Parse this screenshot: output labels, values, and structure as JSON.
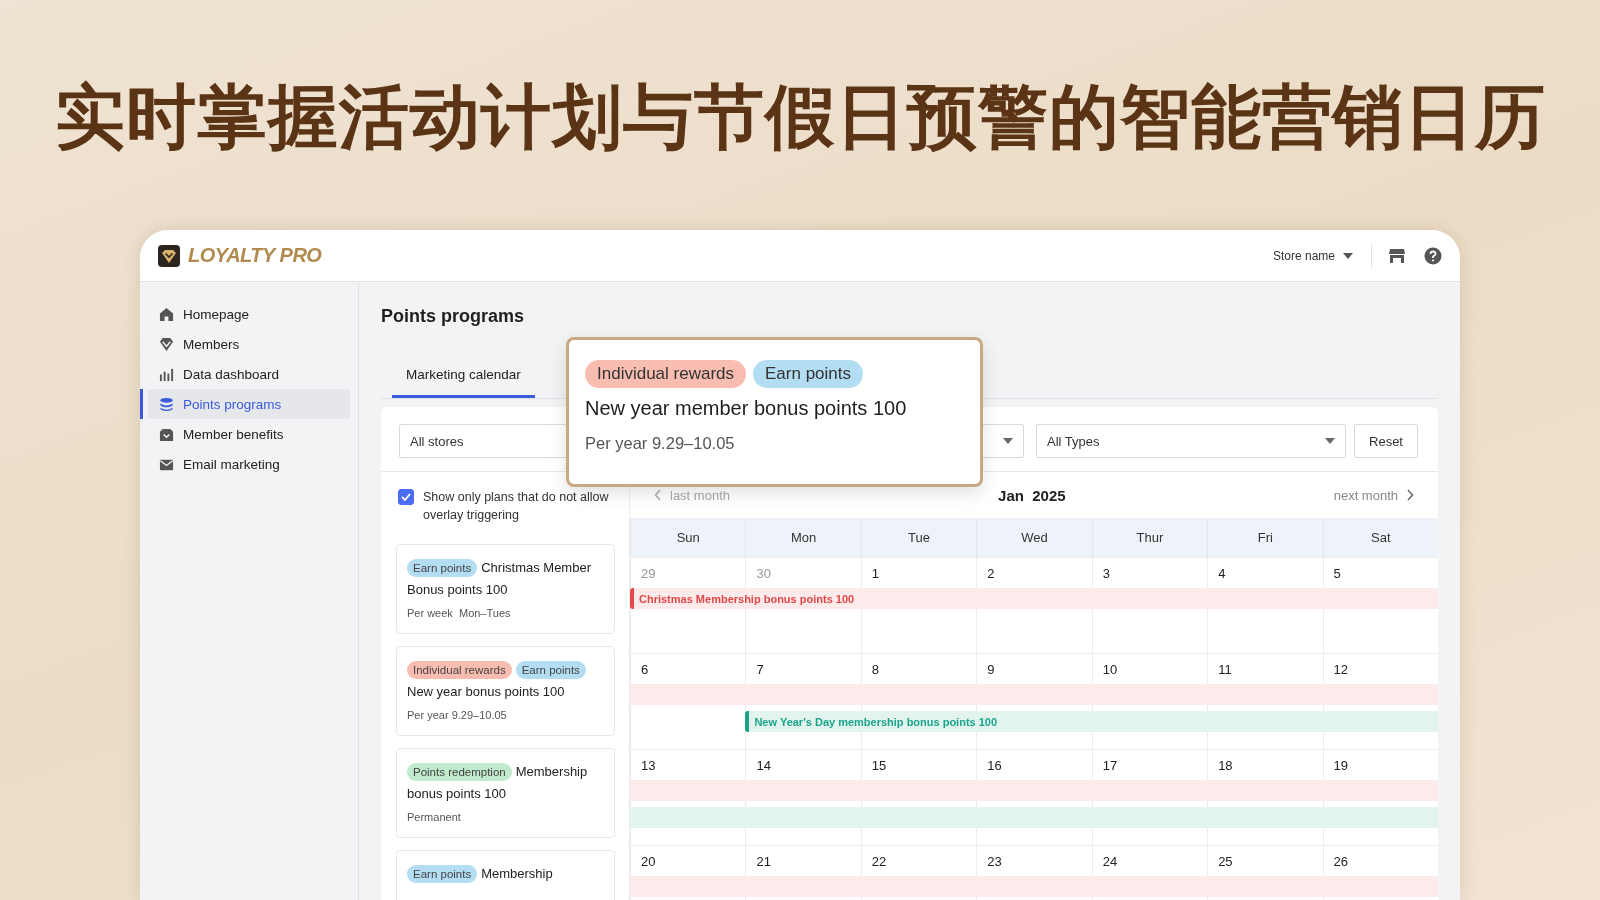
{
  "headline": "实时掌握活动计划与节假日预警的智能营销日历",
  "header": {
    "brand": "LOYALTY PRO",
    "store_selector": "Store name"
  },
  "sidebar": {
    "items": [
      {
        "label": "Homepage",
        "selected": false
      },
      {
        "label": "Members",
        "selected": false
      },
      {
        "label": "Data dashboard",
        "selected": false
      },
      {
        "label": "Points programs",
        "selected": true
      },
      {
        "label": "Member benefits",
        "selected": false
      },
      {
        "label": "Email marketing",
        "selected": false
      }
    ]
  },
  "page_title": "Points programs",
  "tabs": [
    {
      "label": "Marketing calendar",
      "selected": true
    }
  ],
  "filters": {
    "store": "All stores",
    "type": "All Types",
    "reset": "Reset"
  },
  "overlay_filter": {
    "label": "Show only plans that do not allow overlay triggering",
    "checked": true
  },
  "plans": [
    {
      "tags": [
        {
          "label": "Earn points",
          "kind": "earn"
        }
      ],
      "title": [
        "Christmas Member",
        "Bonus points 100"
      ],
      "schedule": "Per week  Mon–Tues"
    },
    {
      "tags": [
        {
          "label": "Individual rewards",
          "kind": "individual"
        },
        {
          "label": "Earn points",
          "kind": "earn"
        }
      ],
      "title": [
        "New year bonus points 100"
      ],
      "schedule": "Per year 9.29–10.05"
    },
    {
      "tags": [
        {
          "label": "Points redemption",
          "kind": "redemption"
        }
      ],
      "title": [
        "Membership",
        "bonus points 100"
      ],
      "schedule": "Permanent"
    },
    {
      "tags": [
        {
          "label": "Earn points",
          "kind": "earn"
        }
      ],
      "title": [
        "Membership"
      ]
    }
  ],
  "popover": {
    "tags": [
      {
        "label": "Individual rewards",
        "kind": "individual"
      },
      {
        "label": "Earn points",
        "kind": "earn"
      }
    ],
    "title": "New year member bonus points 100",
    "schedule": "Per year 9.29–10.05"
  },
  "calendar": {
    "prev": "last month",
    "month": "Jan  2025",
    "next": "next month",
    "weekdays": [
      "Sun",
      "Mon",
      "Tue",
      "Wed",
      "Thur",
      "Fri",
      "Sat"
    ],
    "weeks": [
      {
        "days": [
          {
            "label": "29",
            "muted": true
          },
          {
            "label": "30",
            "muted": true
          },
          {
            "label": "1",
            "muted": false
          },
          {
            "label": "2",
            "muted": false
          },
          {
            "label": "3",
            "muted": false
          },
          {
            "label": "4",
            "muted": false
          },
          {
            "label": "5",
            "muted": false
          }
        ],
        "events": [
          {
            "kind": "primary",
            "skips_first_day": false,
            "continued": false,
            "text": "Christmas Membership bonus points 100"
          }
        ]
      },
      {
        "days": [
          {
            "label": "6",
            "muted": false
          },
          {
            "label": "7",
            "muted": false
          },
          {
            "label": "8",
            "muted": false
          },
          {
            "label": "9",
            "muted": false
          },
          {
            "label": "10",
            "muted": false
          },
          {
            "label": "11",
            "muted": false
          },
          {
            "label": "12",
            "muted": false
          }
        ],
        "events": [
          {
            "kind": "primary",
            "skips_first_day": false,
            "continued": true
          },
          {
            "kind": "secondary",
            "skips_first_day": true,
            "continued": false,
            "text": "New Year's Day membership bonus points 100"
          }
        ]
      },
      {
        "days": [
          {
            "label": "13",
            "muted": false
          },
          {
            "label": "14",
            "muted": false
          },
          {
            "label": "15",
            "muted": false
          },
          {
            "label": "16",
            "muted": false
          },
          {
            "label": "17",
            "muted": false
          },
          {
            "label": "18",
            "muted": false
          },
          {
            "label": "19",
            "muted": false
          }
        ],
        "events": [
          {
            "kind": "primary",
            "skips_first_day": false,
            "continued": true
          },
          {
            "kind": "secondary",
            "skips_first_day": false,
            "continued": true
          }
        ]
      },
      {
        "days": [
          {
            "label": "20",
            "muted": false
          },
          {
            "label": "21",
            "muted": false
          },
          {
            "label": "22",
            "muted": false
          },
          {
            "label": "23",
            "muted": false
          },
          {
            "label": "24",
            "muted": false
          },
          {
            "label": "25",
            "muted": false
          },
          {
            "label": "26",
            "muted": false
          }
        ],
        "events": [
          {
            "kind": "primary",
            "skips_first_day": false,
            "continued": true
          }
        ]
      }
    ]
  }
}
